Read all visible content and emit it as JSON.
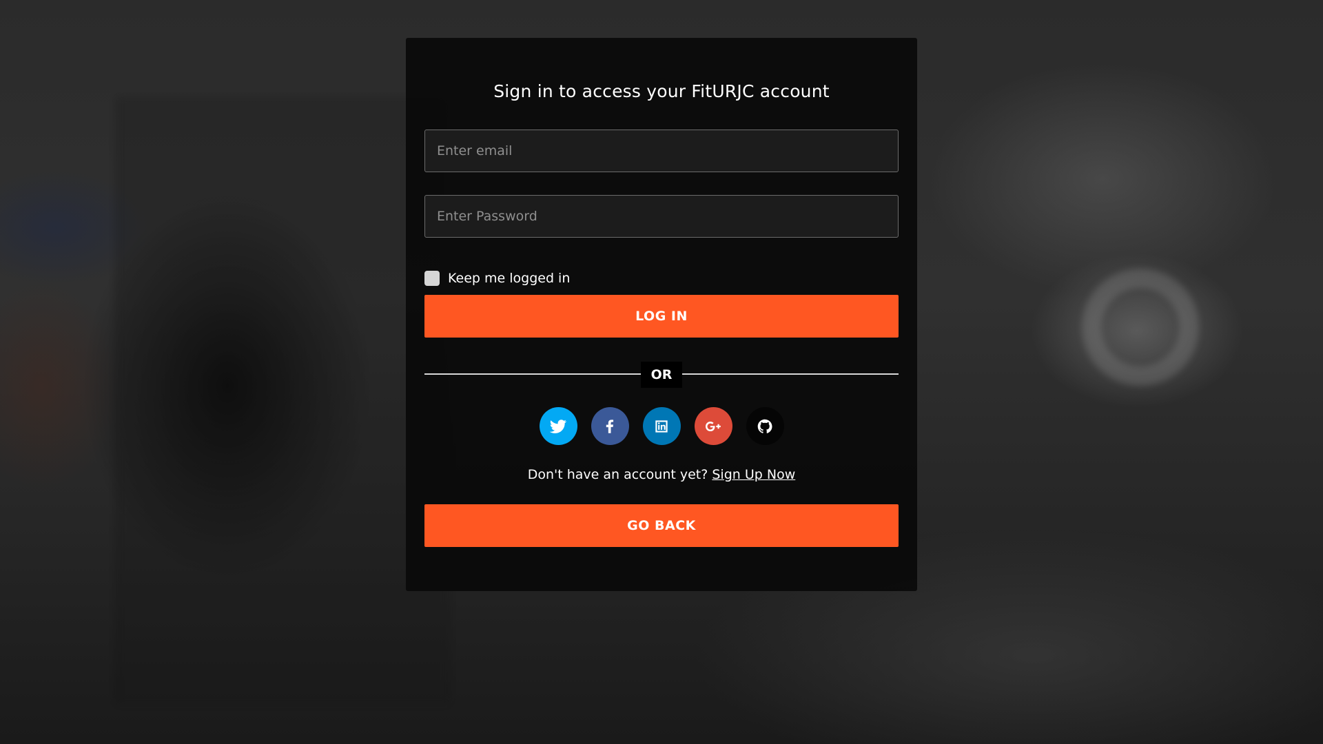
{
  "login": {
    "title": "Sign in to access your FitURJC account",
    "email_placeholder": "Enter email",
    "password_placeholder": "Enter Password",
    "remember_label": "Keep me logged in",
    "login_button": "LOG IN",
    "divider_text": "OR",
    "social": [
      {
        "name": "twitter-icon",
        "color": "#03a9f4"
      },
      {
        "name": "facebook-icon",
        "color": "#3b5998"
      },
      {
        "name": "linkedin-icon",
        "color": "#0077b5"
      },
      {
        "name": "google-plus-icon",
        "color": "#dd4b39"
      },
      {
        "name": "github-icon",
        "color": "#050505"
      }
    ],
    "signup_prompt": "Don't have an account yet?",
    "signup_link": "Sign Up Now",
    "back_button": "GO BACK"
  },
  "colors": {
    "accent": "#ff5722",
    "card_background": "#0a0a0a"
  }
}
